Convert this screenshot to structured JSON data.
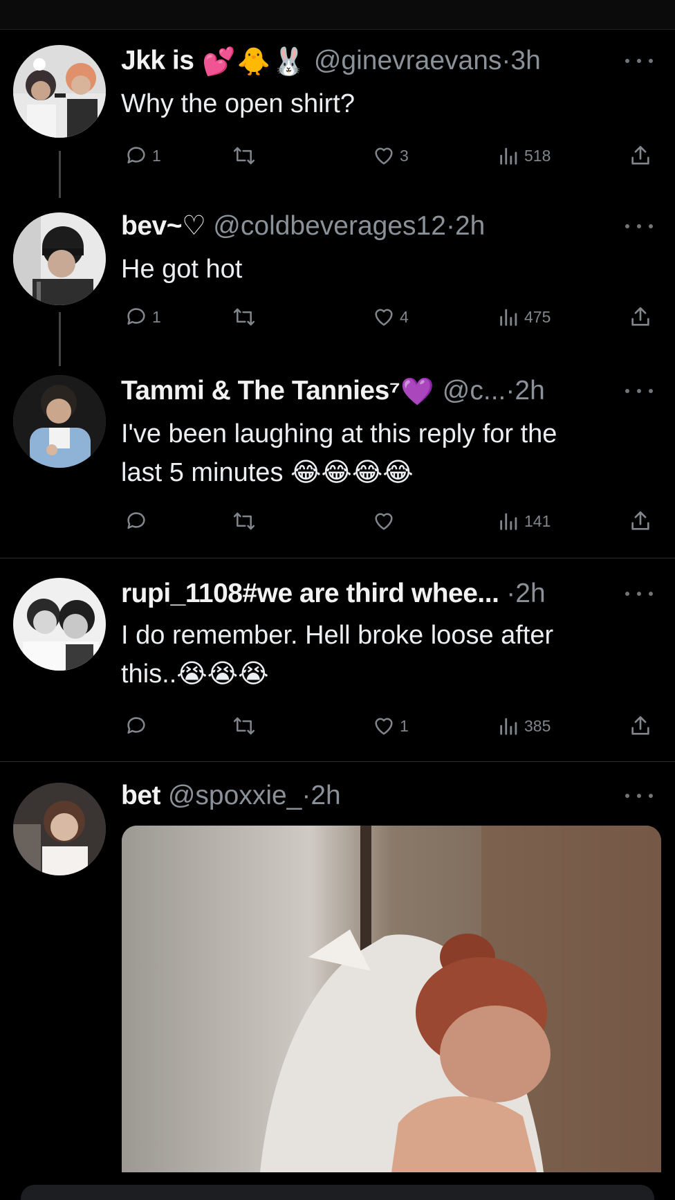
{
  "tweets": [
    {
      "name": "Jkk is",
      "emojis": [
        "💕",
        "🐥",
        "🐰"
      ],
      "handle": "@ginevraevans",
      "time": "3h",
      "text_lines": [
        "Why the open shirt?"
      ],
      "replies": "1",
      "retweets": "",
      "likes": "3",
      "views": "518"
    },
    {
      "name": "bev~♡",
      "emojis": [],
      "handle": "@coldbeverages12",
      "time": "2h",
      "text_lines": [
        "He got hot"
      ],
      "replies": "1",
      "retweets": "",
      "likes": "4",
      "views": "475"
    },
    {
      "name": "Tammi & The Tannies⁷",
      "emojis": [
        "💜"
      ],
      "handle": "@c...",
      "time": "2h",
      "text_lines": [
        "I've been laughing at this reply for the",
        "last 5 minutes"
      ],
      "text_emojis": [
        "😂",
        "😂",
        "😂",
        "😂"
      ],
      "replies": "",
      "retweets": "",
      "likes": "",
      "views": "141"
    },
    {
      "name": "rupi_1108#we are third whee...",
      "emojis": [],
      "handle": "",
      "time": "2h",
      "text_lines": [
        "I do remember. Hell broke loose after",
        "this.."
      ],
      "text_emojis": [
        "😭",
        "😭",
        "😭"
      ],
      "replies": "",
      "retweets": "",
      "likes": "1",
      "views": "385"
    },
    {
      "name": "bet",
      "emojis": [],
      "handle": "@spoxxie_",
      "time": "2h",
      "text_lines": [],
      "media": "embedded-image"
    }
  ],
  "separator": "·",
  "icons": {
    "reply": "reply-icon",
    "retweet": "retweet-icon",
    "like": "heart-icon",
    "views": "views-icon",
    "share": "share-icon",
    "more": "more-icon"
  },
  "colors": {
    "background": "#000000",
    "text": "#e7e9ea",
    "secondary": "#71767b",
    "heart_emoji": "#a855f7"
  }
}
